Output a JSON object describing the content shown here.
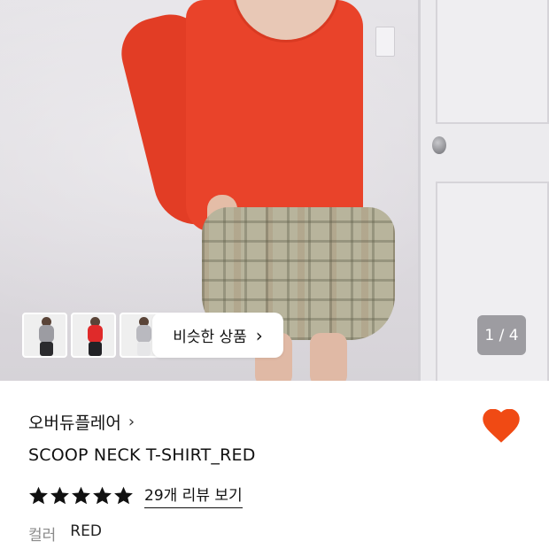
{
  "gallery": {
    "page_counter": "1 / 4",
    "similar_products_label": "비슷한 상품",
    "thumbnails": [
      {
        "name": "gray-tee",
        "top_color": "#9c9ca2",
        "bottom_color": "#2b2b2e"
      },
      {
        "name": "red-tee",
        "top_color": "#e02a2a",
        "bottom_color": "#222226"
      },
      {
        "name": "gray-tee-light",
        "top_color": "#b9b9bf",
        "bottom_color": "#e6e6e8"
      }
    ]
  },
  "product": {
    "brand": "오버듀플레어",
    "title": "SCOOP NECK T-SHIRT_RED",
    "rating_stars": 5,
    "review_link": "29개 리뷰 보기",
    "option_label": "컬러",
    "option_value": "RED",
    "wishlisted": true
  },
  "colors": {
    "heart": "#f04a14",
    "star": "#111111"
  }
}
